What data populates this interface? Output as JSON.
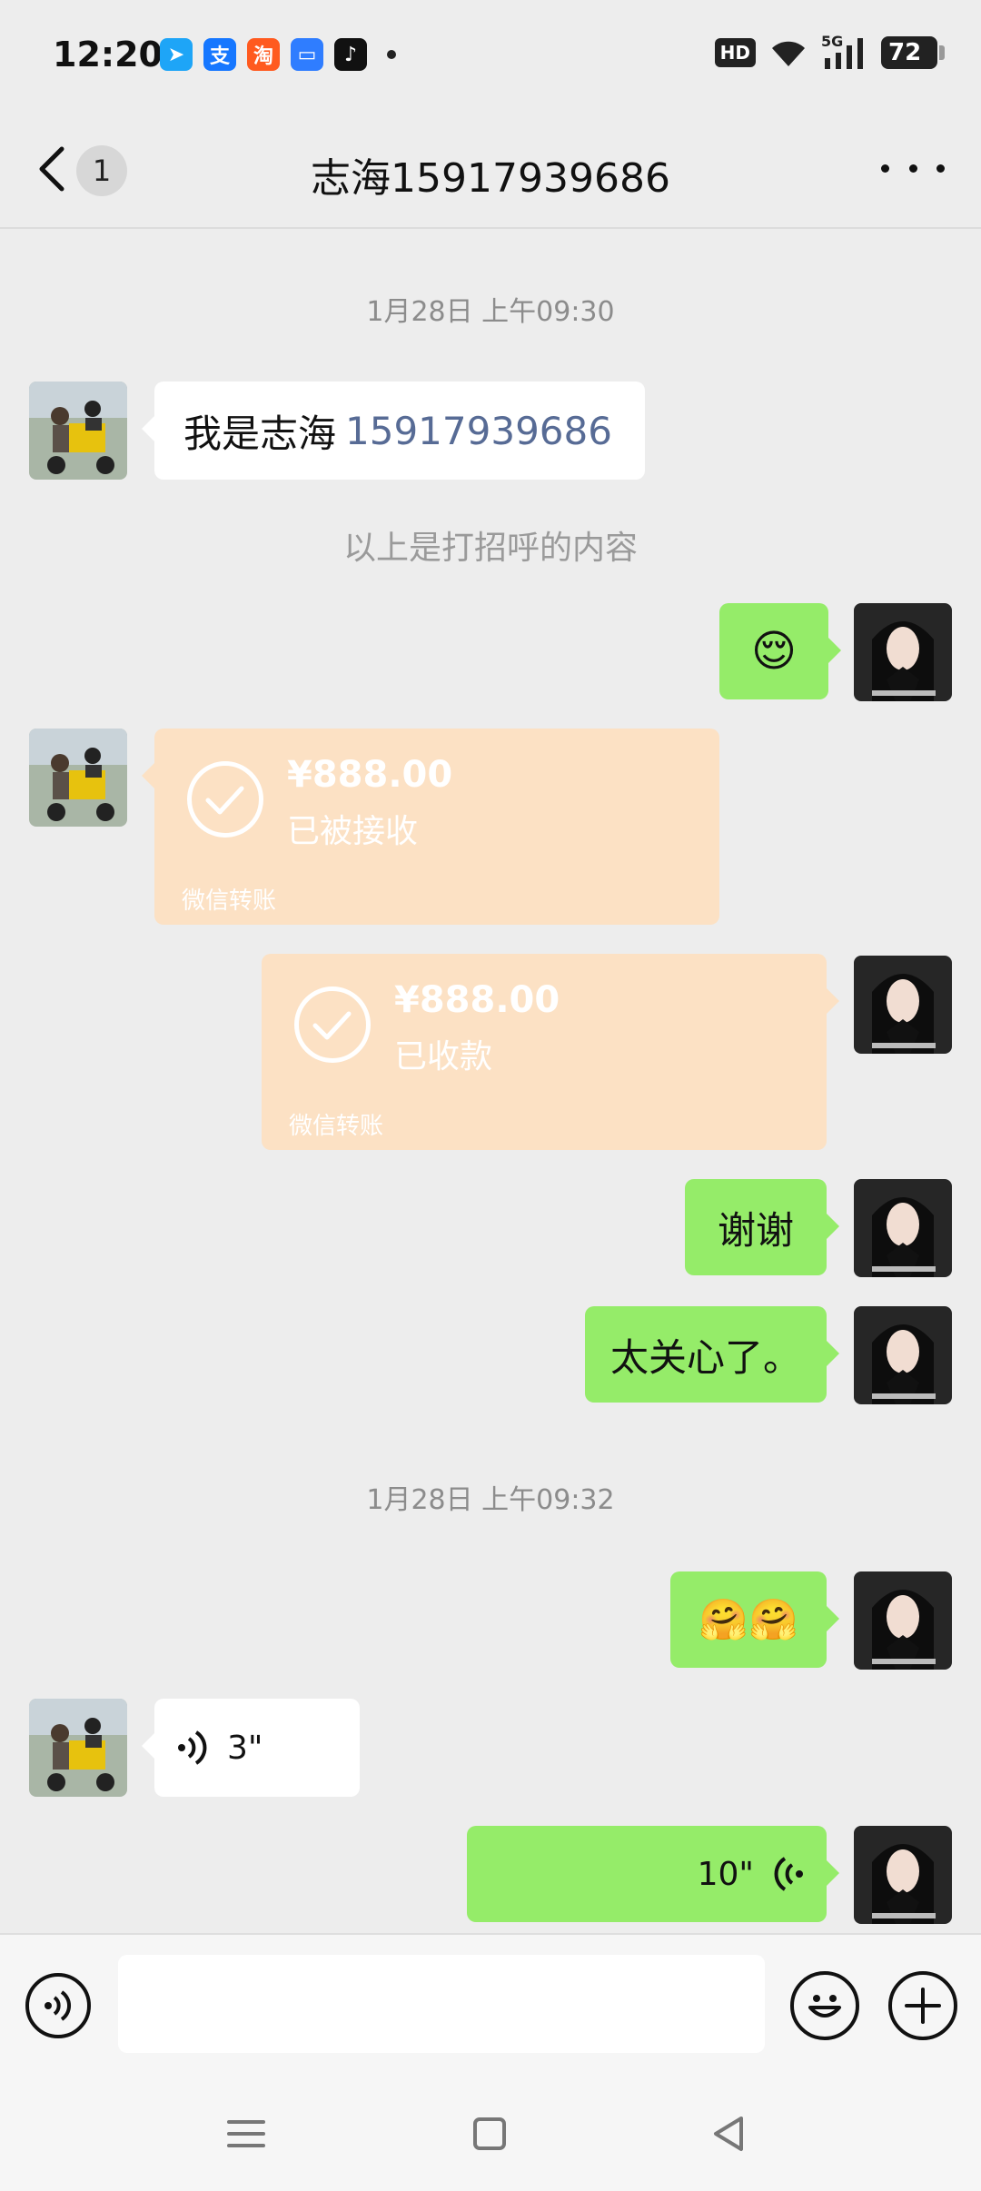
{
  "status_bar": {
    "time": "12:20",
    "app_icons": [
      {
        "name": "feishu-icon",
        "color": "#1ea5f7",
        "glyph": "➤"
      },
      {
        "name": "alipay-icon",
        "color": "#1677ff",
        "glyph": "支"
      },
      {
        "name": "taobao-icon",
        "color": "#ff5a1f",
        "glyph": "淘"
      },
      {
        "name": "files-icon",
        "color": "#2f7dff",
        "glyph": "▭"
      },
      {
        "name": "tiktok-icon",
        "color": "#111111",
        "glyph": "♪"
      }
    ],
    "hd_label": "HD",
    "network_label": "5G",
    "battery_level": "72"
  },
  "header": {
    "back_badge": "1",
    "title": "志海15917939686"
  },
  "chat": {
    "timestamp_1": "1月28日 上午09:30",
    "greeting_prefix": "我是志海",
    "greeting_number": "15917939686",
    "system_note": "以上是打招呼的内容",
    "emoji_1": "😌",
    "transfer_received": {
      "amount": "¥888.00",
      "status": "已被接收",
      "brand": "微信转账"
    },
    "transfer_sent": {
      "amount": "¥888.00",
      "status": "已收款",
      "brand": "微信转账"
    },
    "message_thanks": "谢谢",
    "message_caring": "太关心了。",
    "timestamp_2": "1月28日 上午09:32",
    "emoji_pair": "🤗🤗",
    "voice_in_duration": "3\"",
    "voice_out_duration": "10\""
  },
  "colors": {
    "self_bubble": "#95ec69",
    "other_bubble": "#ffffff",
    "transfer_bubble": "#fce1c4",
    "link_number": "#576b95",
    "background": "#ededed"
  }
}
